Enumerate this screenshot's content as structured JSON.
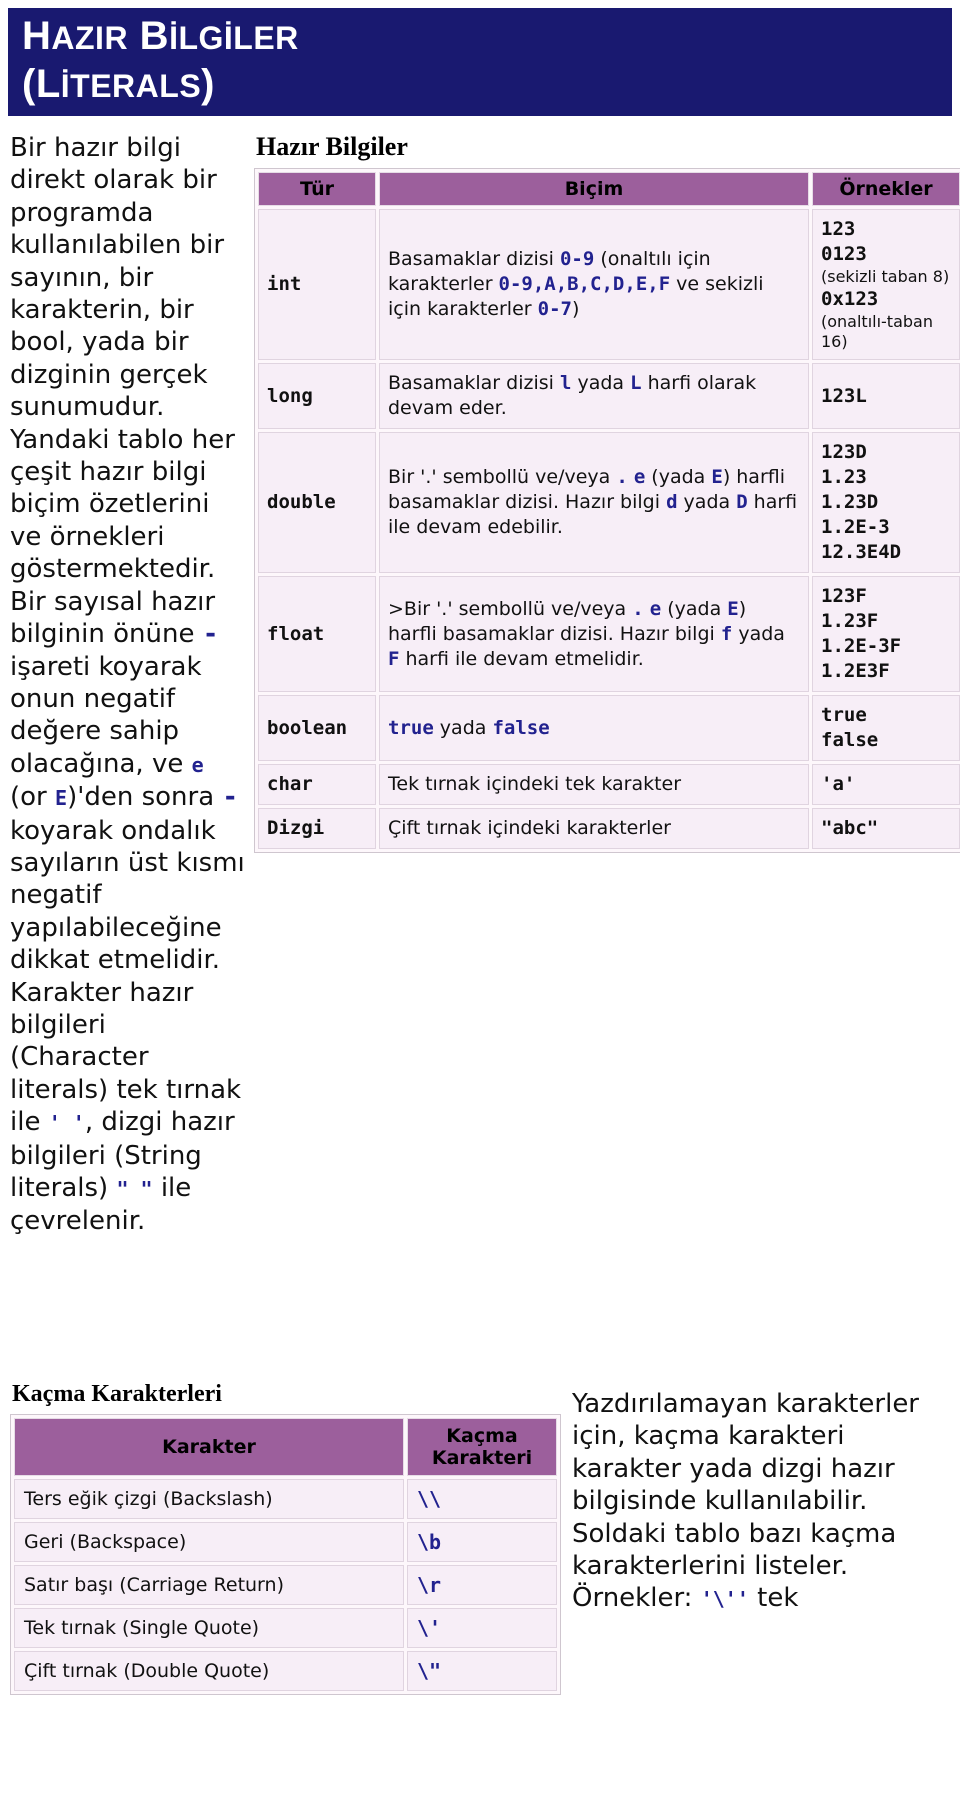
{
  "title": {
    "line1_first": "H",
    "line1_rest": "AZIR",
    "line1_second_first": "B",
    "line1_second_rest": "İLGİLER",
    "line2_paren_open": "(",
    "line2_first": "L",
    "line2_rest": "İTERALS",
    "line2_paren_close": ")",
    "full": "HAZIR BİLGİLER (LİTERALS)",
    "bg_color": "#191970",
    "text_color": "#ffffff"
  },
  "left_text": {
    "p1_a": "Bir hazır bilgi direkt olarak bir programda kullanılabilen bir sayının, bir karakterin, bir bool, yada bir dizginin gerçek sunumudur. Yandaki tablo her çeşit hazır bilgi biçim özetlerini ve örnekleri göstermektedir. Bir sayısal hazır bilginin önüne ",
    "code_minus1": "-",
    "p1_b": " işareti koyarak onun negatif değere sahip olacağına, ve ",
    "code_e": "e",
    "p1_c": " (or ",
    "code_E": "E",
    "p1_d": ")'den sonra ",
    "code_minus2": "-",
    "p1_e": " koyarak ondalık sayıların üst kısmı negatif yapılabileceğine dikkat etmelidir. Karakter hazır bilgileri (Character literals) tek tırnak ile ",
    "code_squote": "' '",
    "p1_f": ", dizgi hazır bilgileri (String literals) ",
    "code_dquote": "\" \"",
    "p1_g": " ile çevrelenir."
  },
  "main_table": {
    "caption": "Hazır Bilgiler",
    "header_bg": "#9c5f9c",
    "cell_bg": "#f7eef7",
    "code_color": "#22228f",
    "columns": [
      "Tür",
      "Biçim",
      "Örnekler"
    ],
    "rows": [
      {
        "type": "int",
        "format_parts": [
          {
            "t": "text",
            "v": "Basamaklar dizisi "
          },
          {
            "t": "code",
            "v": "0-9"
          },
          {
            "t": "text",
            "v": " (onaltılı için karakterler "
          },
          {
            "t": "code",
            "v": "0-9,A,B,C,D,E,F"
          },
          {
            "t": "text",
            "v": " ve sekizli için karakterler "
          },
          {
            "t": "code",
            "v": "0-7"
          },
          {
            "t": "text",
            "v": ")"
          }
        ],
        "examples": [
          {
            "t": "code",
            "v": "123"
          },
          {
            "t": "code",
            "v": "0123"
          },
          {
            "t": "note",
            "v": "(sekizli taban 8)"
          },
          {
            "t": "code",
            "v": "0x123"
          },
          {
            "t": "note",
            "v": "(onaltılı-taban 16)"
          }
        ]
      },
      {
        "type": "long",
        "format_parts": [
          {
            "t": "text",
            "v": "Basamaklar dizisi "
          },
          {
            "t": "code",
            "v": "l"
          },
          {
            "t": "text",
            "v": " yada "
          },
          {
            "t": "code",
            "v": "L"
          },
          {
            "t": "text",
            "v": " harfi olarak devam eder."
          }
        ],
        "examples": [
          {
            "t": "code",
            "v": "123L"
          }
        ]
      },
      {
        "type": "double",
        "format_parts": [
          {
            "t": "text",
            "v": "Bir '.' sembollü ve/veya "
          },
          {
            "t": "code",
            "v": "."
          },
          {
            "t": "text",
            "v": " "
          },
          {
            "t": "code",
            "v": "e"
          },
          {
            "t": "text",
            "v": " (yada "
          },
          {
            "t": "code",
            "v": "E"
          },
          {
            "t": "text",
            "v": ") harfli basamaklar dizisi. Hazır bilgi "
          },
          {
            "t": "code",
            "v": "d"
          },
          {
            "t": "text",
            "v": " yada "
          },
          {
            "t": "code",
            "v": "D"
          },
          {
            "t": "text",
            "v": " harfi ile devam edebilir."
          }
        ],
        "examples": [
          {
            "t": "code",
            "v": "123D"
          },
          {
            "t": "code",
            "v": "1.23"
          },
          {
            "t": "code",
            "v": "1.23D"
          },
          {
            "t": "code",
            "v": "1.2E-3"
          },
          {
            "t": "code",
            "v": "12.3E4D"
          }
        ]
      },
      {
        "type": "float",
        "format_parts": [
          {
            "t": "text",
            "v": ">Bir '.' sembollü ve/veya "
          },
          {
            "t": "code",
            "v": "."
          },
          {
            "t": "text",
            "v": " "
          },
          {
            "t": "code",
            "v": "e"
          },
          {
            "t": "text",
            "v": " (yada "
          },
          {
            "t": "code",
            "v": "E"
          },
          {
            "t": "text",
            "v": ") harfli basamaklar dizisi. Hazır bilgi "
          },
          {
            "t": "code",
            "v": "f"
          },
          {
            "t": "text",
            "v": " yada "
          },
          {
            "t": "code",
            "v": "F"
          },
          {
            "t": "text",
            "v": " harfi ile devam etmelidir."
          }
        ],
        "examples": [
          {
            "t": "code",
            "v": "123F"
          },
          {
            "t": "code",
            "v": "1.23F"
          },
          {
            "t": "code",
            "v": "1.2E-3F"
          },
          {
            "t": "code",
            "v": "1.2E3F"
          }
        ]
      },
      {
        "type": "boolean",
        "format_parts": [
          {
            "t": "code",
            "v": "true"
          },
          {
            "t": "text",
            "v": " yada "
          },
          {
            "t": "code",
            "v": "false"
          }
        ],
        "examples": [
          {
            "t": "code",
            "v": "true"
          },
          {
            "t": "code",
            "v": "false"
          }
        ]
      },
      {
        "type": "char",
        "format_parts": [
          {
            "t": "text",
            "v": "Tek tırnak içindeki tek karakter"
          }
        ],
        "examples": [
          {
            "t": "code",
            "v": "'a'"
          }
        ]
      },
      {
        "type": "Dizgi",
        "format_parts": [
          {
            "t": "text",
            "v": "Çift tırnak içindeki karakterler"
          }
        ],
        "examples": [
          {
            "t": "code",
            "v": "\"abc\""
          }
        ]
      }
    ]
  },
  "escape_table": {
    "caption": "Kaçma Karakterleri",
    "columns": [
      "Karakter",
      "Kaçma Karakteri"
    ],
    "rows": [
      {
        "name": "Ters eğik çizgi (Backslash)",
        "esc": "\\\\"
      },
      {
        "name": "Geri (Backspace)",
        "esc": "\\b"
      },
      {
        "name": "Satır başı (Carriage Return)",
        "esc": "\\r"
      },
      {
        "name": "Tek tırnak (Single Quote)",
        "esc": "\\'"
      },
      {
        "name": "Çift tırnak (Double Quote)",
        "esc": "\\\""
      }
    ]
  },
  "right_text": {
    "a": "Yazdırılamayan karakterler için, kaçma karakteri karakter yada dizgi hazır bilgisinde kullanılabilir. Soldaki tablo bazı kaçma karakterlerini listeler. Örnekler: ",
    "code1": "'\\''",
    "b": " tek "
  }
}
